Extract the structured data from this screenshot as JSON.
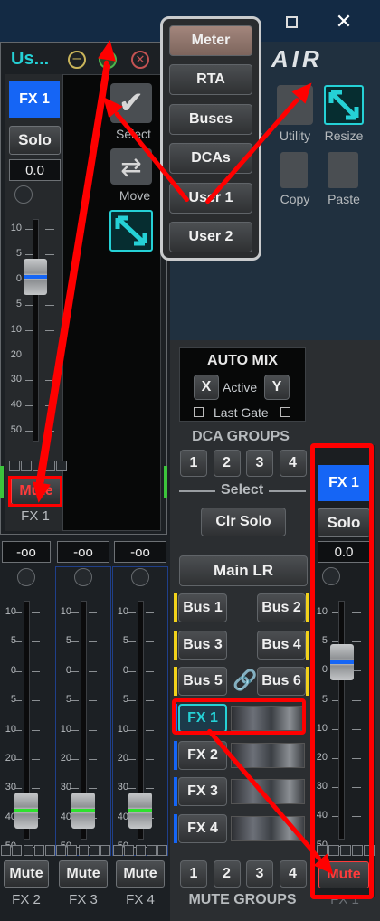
{
  "window": {
    "title": "Us...",
    "brand": "AIR"
  },
  "popup_menu": {
    "items": [
      "Meter",
      "RTA",
      "Buses",
      "DCAs",
      "User 1",
      "User 2"
    ],
    "selected": "Meter"
  },
  "toolbar": {
    "select": "Select",
    "move": "Move",
    "utility": "Utility",
    "resize": "Resize",
    "copy": "Copy",
    "paste": "Paste"
  },
  "float_strip": {
    "label": "FX 1",
    "solo": "Solo",
    "gain": "0.0",
    "mute": "Mute",
    "name": "FX 1",
    "scale": [
      "10",
      "5",
      "0",
      "5",
      "10",
      "20",
      "30",
      "40",
      "50"
    ]
  },
  "bottom_strips": [
    {
      "gain": "-oo",
      "mute": "Mute",
      "name": "FX 2"
    },
    {
      "gain": "-oo",
      "mute": "Mute",
      "name": "FX 3"
    },
    {
      "gain": "-oo",
      "mute": "Mute",
      "name": "FX 4"
    }
  ],
  "bottom_scale": [
    "10",
    "5",
    "0",
    "5",
    "10",
    "20",
    "30",
    "40",
    "50"
  ],
  "automix": {
    "title": "AUTO MIX",
    "x": "X",
    "active": "Active",
    "y": "Y",
    "last_gate": "Last Gate"
  },
  "dca": {
    "title": "DCA GROUPS",
    "buttons": [
      "1",
      "2",
      "3",
      "4"
    ],
    "select": "Select",
    "clr_solo": "Clr Solo"
  },
  "main_lr": "Main LR",
  "buses": [
    "Bus 1",
    "Bus 2",
    "Bus 3",
    "Bus 4",
    "Bus 5",
    "Bus 6"
  ],
  "fx": [
    "FX 1",
    "FX 2",
    "FX 3",
    "FX 4"
  ],
  "mute_groups": {
    "title": "MUTE GROUPS",
    "buttons": [
      "1",
      "2",
      "3",
      "4"
    ]
  },
  "right_strip": {
    "label": "FX 1",
    "solo": "Solo",
    "gain": "0.0",
    "mute": "Mute",
    "name": "FX 1",
    "scale": [
      "10",
      "5",
      "0",
      "5",
      "10",
      "20",
      "30",
      "40",
      "50"
    ]
  },
  "colors": {
    "accent_blue": "#1565f5",
    "cyan": "#25d1d6",
    "mute_red": "#ff3b3b",
    "annotation_red": "#ff0000",
    "bus_yellow": "#f2d21b"
  }
}
